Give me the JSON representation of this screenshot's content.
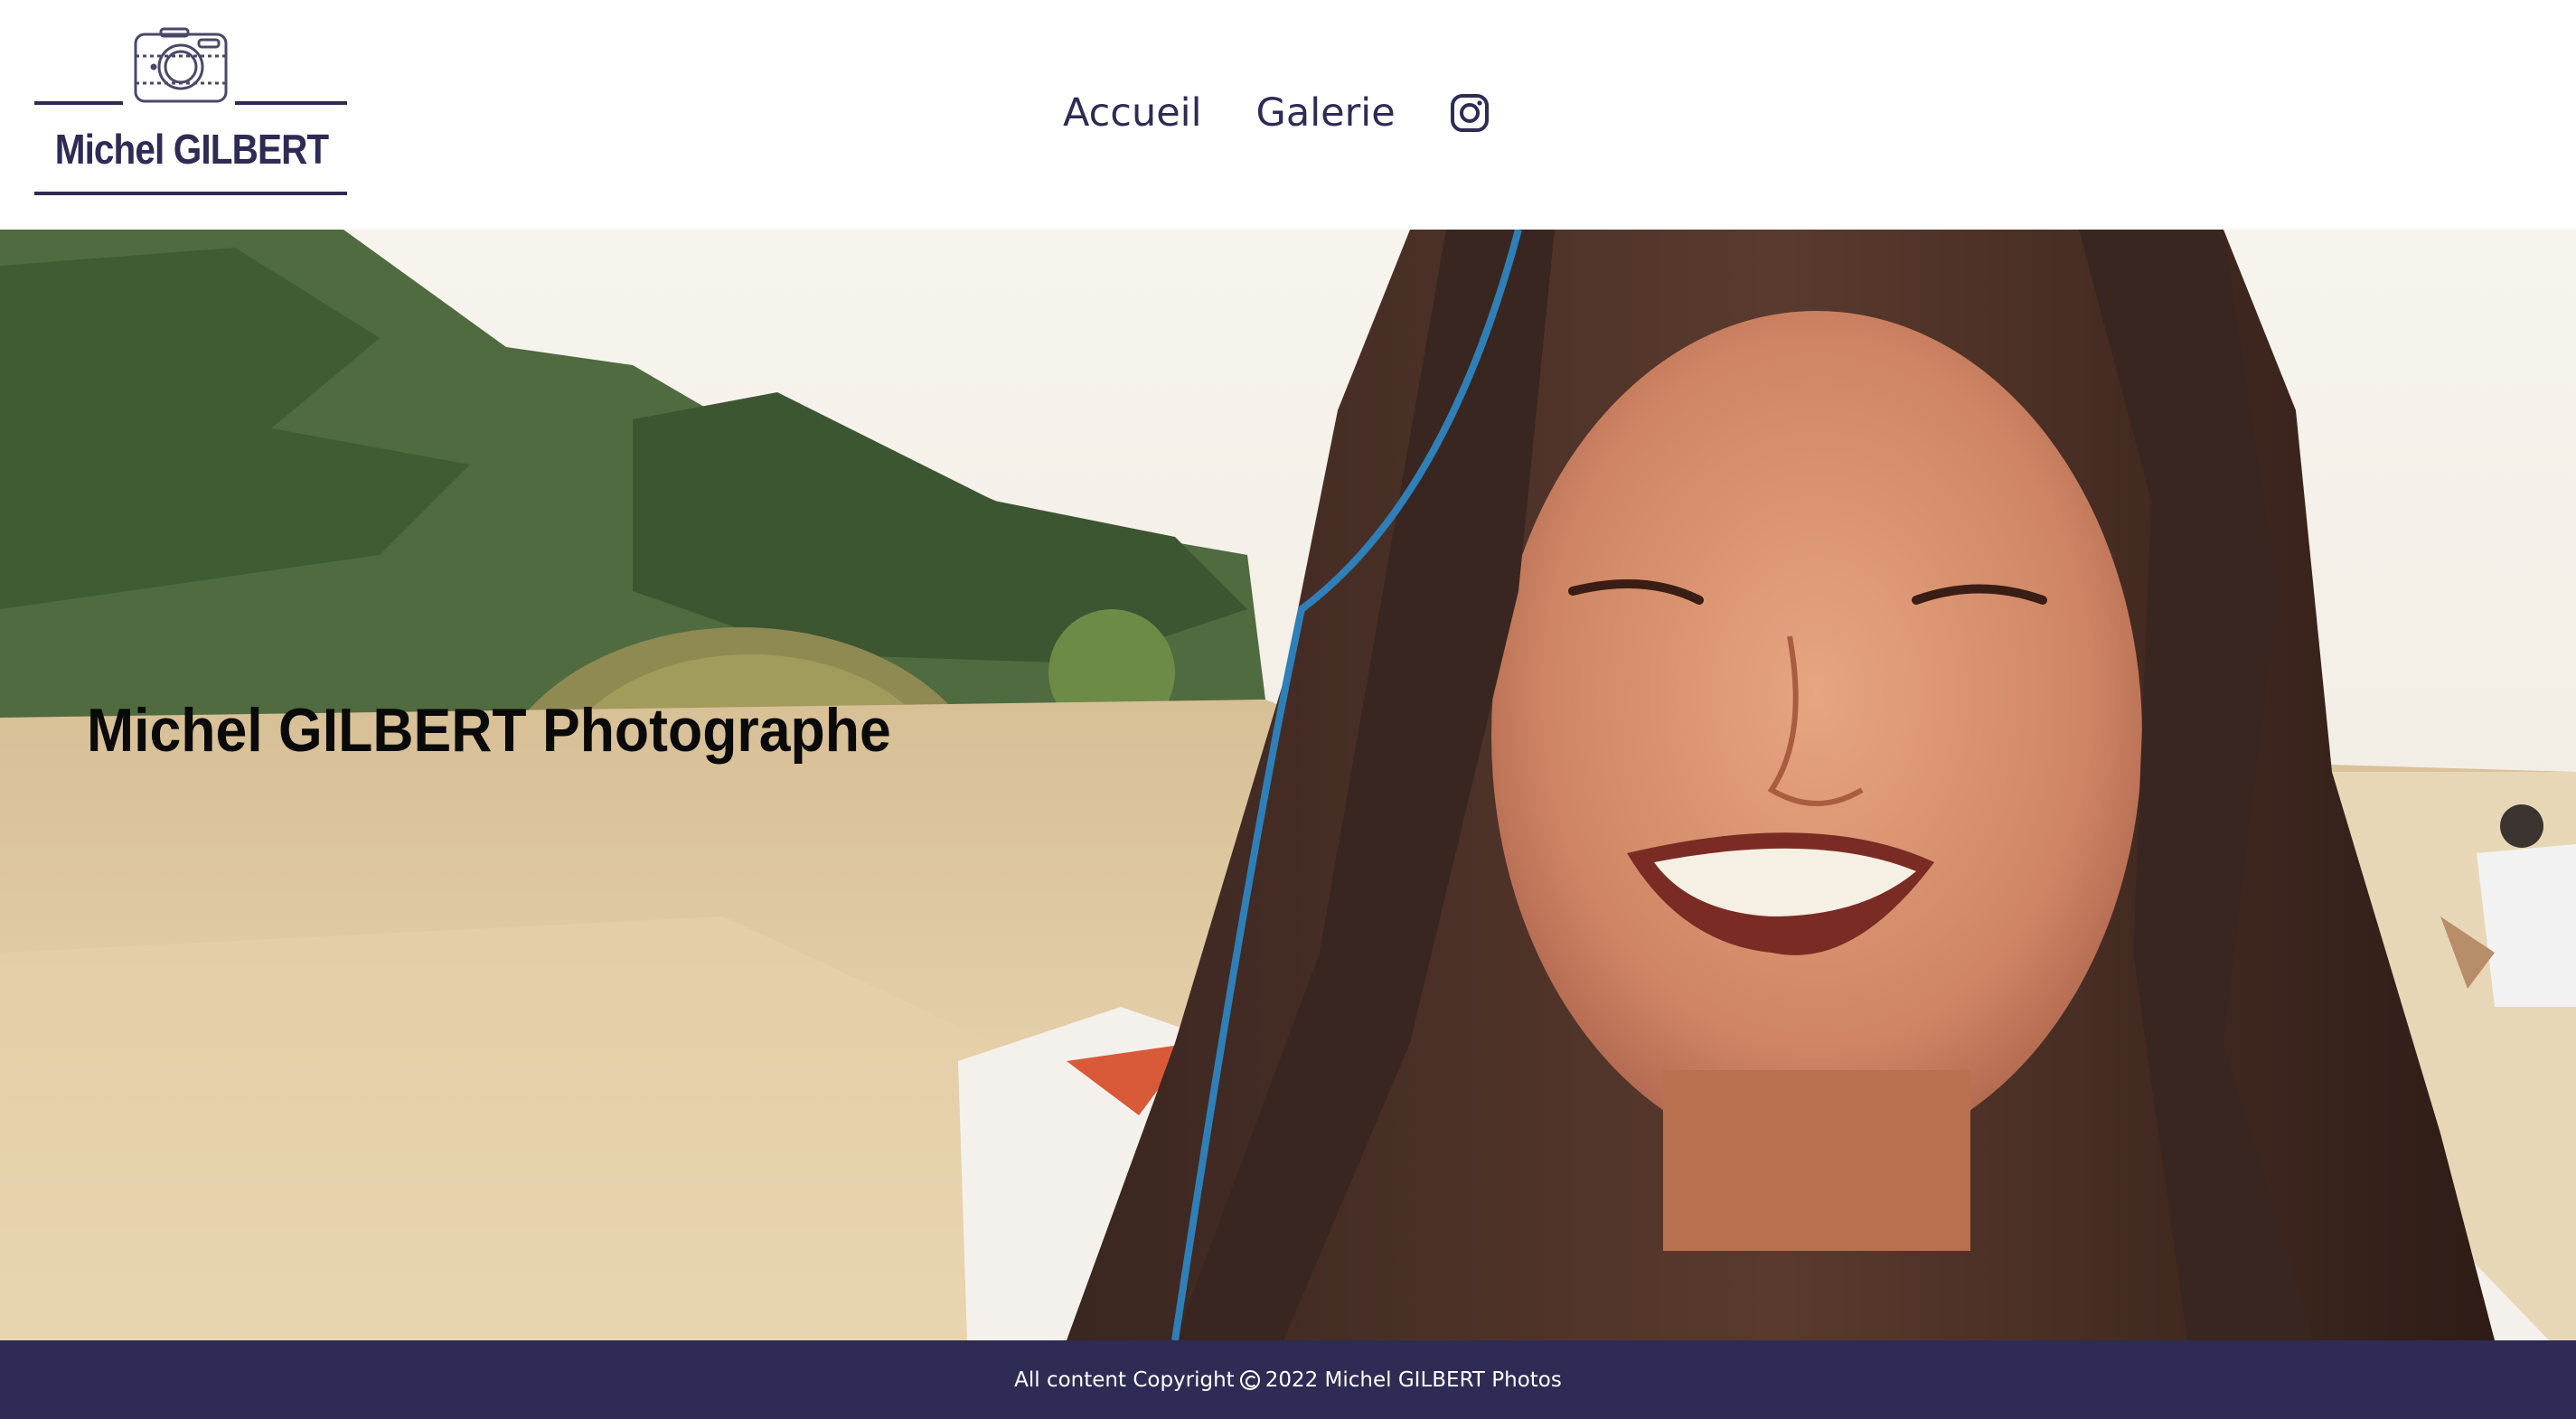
{
  "header": {
    "logo_text": "Michel GILBERT",
    "nav": [
      {
        "label": "Accueil"
      },
      {
        "label": "Galerie"
      }
    ],
    "instagram_icon": "instagram-icon"
  },
  "hero": {
    "title": "Michel GILBERT Photographe",
    "image_description": "smiling-girl-photo"
  },
  "footer": {
    "prefix": "All content Copyright",
    "suffix": "2022 Michel GILBERT Photos",
    "copyright_icon": "copyright-icon"
  },
  "colors": {
    "brand": "#2e2b55",
    "footer_bg": "#2e2b55",
    "header_bg": "#ffffff"
  }
}
